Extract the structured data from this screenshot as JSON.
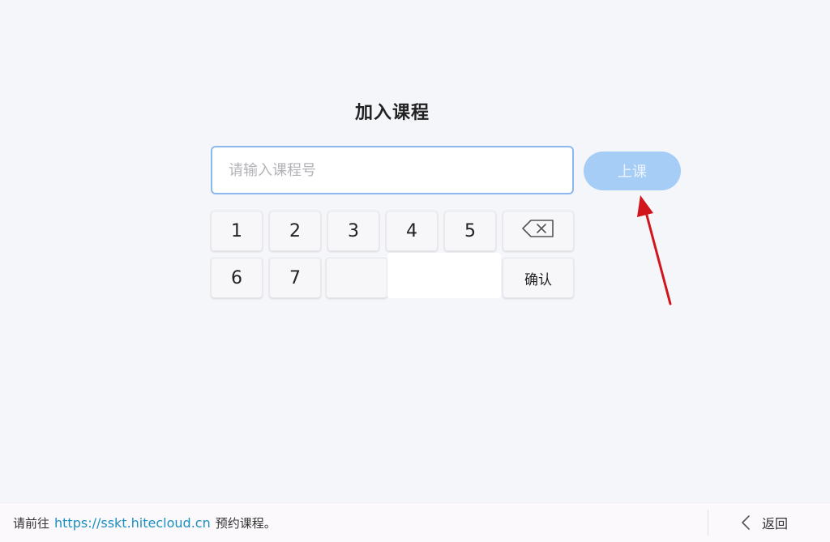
{
  "page": {
    "title": "加入课程"
  },
  "course_input": {
    "placeholder": "请输入课程号",
    "value": ""
  },
  "join_button": {
    "label": "上课"
  },
  "keypad": {
    "row1": [
      "1",
      "2",
      "3",
      "4",
      "5"
    ],
    "row2": [
      "6",
      "7"
    ],
    "backspace_icon": "backspace-icon",
    "confirm_label": "确认"
  },
  "footer": {
    "prefix": "请前往",
    "link": "https://sskt.hitecloud.cn",
    "suffix": "预约课程。",
    "back_label": "返回",
    "back_icon": "chevron-left-icon"
  },
  "colors": {
    "background": "#f5f6fa",
    "input_border": "#8db8ee",
    "join_button_bg": "#a6cdf6",
    "link": "#1c8fbf",
    "annotation_arrow": "#d0161c"
  }
}
